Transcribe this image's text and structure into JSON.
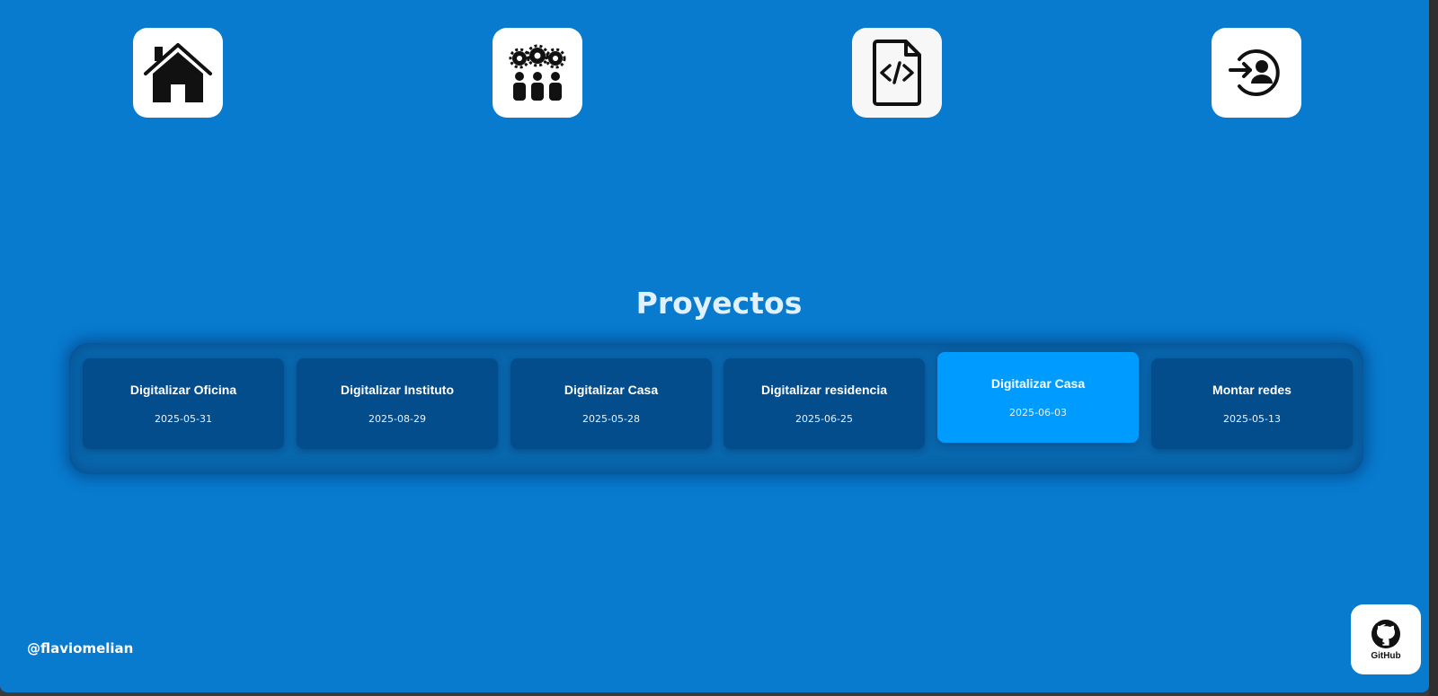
{
  "nav": {
    "buttons": [
      {
        "icon": "home-icon"
      },
      {
        "icon": "team-settings-icon"
      },
      {
        "icon": "code-file-icon"
      },
      {
        "icon": "login-icon"
      }
    ]
  },
  "section": {
    "title": "Proyectos"
  },
  "projects": [
    {
      "name": "Digitalizar Oficina",
      "date": "2025-05-31"
    },
    {
      "name": "Digitalizar Instituto",
      "date": "2025-08-29"
    },
    {
      "name": "Digitalizar Casa",
      "date": "2025-05-28"
    },
    {
      "name": "Digitalizar residencia",
      "date": "2025-06-25"
    },
    {
      "name": "Digitalizar Casa",
      "date": "2025-06-03"
    },
    {
      "name": "Montar redes",
      "date": "2025-05-13"
    }
  ],
  "active_project_index": 4,
  "footer": {
    "handle": "@flaviomelian",
    "github_label": "GitHub"
  },
  "colors": {
    "background": "#087bcf",
    "card": "#044d8d",
    "card_active": "#009bff",
    "title": "#dff1ff"
  }
}
